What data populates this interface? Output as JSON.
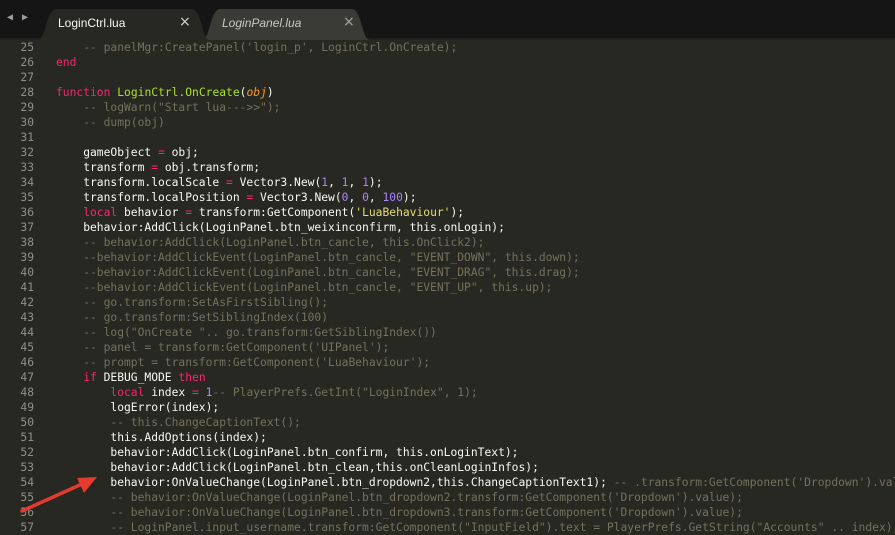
{
  "tabs": [
    {
      "label": "LoginCtrl.lua",
      "close": "×",
      "active": true
    },
    {
      "label": "LoginPanel.lua",
      "close": "×",
      "active": false
    }
  ],
  "nav": {
    "prev": "◀",
    "next": "▶"
  },
  "colors": {
    "background": "#272822",
    "keyword": "#f92672",
    "function": "#a6e22e",
    "string": "#e6db74",
    "number": "#ae81ff",
    "comment": "#75715e",
    "annotation_arrow": "#e53a2f"
  },
  "lines": [
    {
      "n": "25",
      "indent": 4,
      "tokens": [
        {
          "t": "-- panelMgr:CreatePanel('login_p', LoginCtrl.OnCreate);",
          "c": "cm"
        }
      ]
    },
    {
      "n": "26",
      "indent": 0,
      "tokens": [
        {
          "t": "end",
          "c": "kw"
        }
      ]
    },
    {
      "n": "27",
      "indent": 0,
      "tokens": []
    },
    {
      "n": "28",
      "indent": 0,
      "tokens": [
        {
          "t": "function",
          "c": "kw"
        },
        {
          "t": " "
        },
        {
          "t": "LoginCtrl.OnCreate",
          "c": "fn"
        },
        {
          "t": "("
        },
        {
          "t": "obj",
          "c": "param"
        },
        {
          "t": ")"
        }
      ]
    },
    {
      "n": "29",
      "indent": 4,
      "tokens": [
        {
          "t": "-- logWarn(\"Start lua--->>\");",
          "c": "cm"
        }
      ]
    },
    {
      "n": "30",
      "indent": 4,
      "tokens": [
        {
          "t": "-- dump(obj)",
          "c": "cm"
        }
      ]
    },
    {
      "n": "31",
      "indent": 0,
      "tokens": []
    },
    {
      "n": "32",
      "indent": 4,
      "tokens": [
        {
          "t": "gameObject "
        },
        {
          "t": "=",
          "c": "op"
        },
        {
          "t": " obj;"
        }
      ]
    },
    {
      "n": "33",
      "indent": 4,
      "tokens": [
        {
          "t": "transform "
        },
        {
          "t": "=",
          "c": "op"
        },
        {
          "t": " obj.transform;"
        }
      ]
    },
    {
      "n": "34",
      "indent": 4,
      "tokens": [
        {
          "t": "transform.localScale "
        },
        {
          "t": "=",
          "c": "op"
        },
        {
          "t": " Vector3.New("
        },
        {
          "t": "1",
          "c": "num"
        },
        {
          "t": ", "
        },
        {
          "t": "1",
          "c": "num"
        },
        {
          "t": ", "
        },
        {
          "t": "1",
          "c": "num"
        },
        {
          "t": ");"
        }
      ]
    },
    {
      "n": "35",
      "indent": 4,
      "tokens": [
        {
          "t": "transform.localPosition "
        },
        {
          "t": "=",
          "c": "op"
        },
        {
          "t": " Vector3.New("
        },
        {
          "t": "0",
          "c": "num"
        },
        {
          "t": ", "
        },
        {
          "t": "0",
          "c": "num"
        },
        {
          "t": ", "
        },
        {
          "t": "100",
          "c": "num"
        },
        {
          "t": ");"
        }
      ]
    },
    {
      "n": "36",
      "indent": 4,
      "tokens": [
        {
          "t": "local",
          "c": "kw"
        },
        {
          "t": " behavior "
        },
        {
          "t": "=",
          "c": "op"
        },
        {
          "t": " transform:GetComponent("
        },
        {
          "t": "'LuaBehaviour'",
          "c": "str"
        },
        {
          "t": ");"
        }
      ]
    },
    {
      "n": "37",
      "indent": 4,
      "tokens": [
        {
          "t": "behavior:AddClick(LoginPanel.btn_weixinconfirm, this.onLogin);"
        }
      ]
    },
    {
      "n": "38",
      "indent": 4,
      "tokens": [
        {
          "t": "-- behavior:AddClick(LoginPanel.btn_cancle, this.OnClick2);",
          "c": "cm"
        }
      ]
    },
    {
      "n": "39",
      "indent": 4,
      "tokens": [
        {
          "t": "--behavior:AddClickEvent(LoginPanel.btn_cancle, \"EVENT_DOWN\", this.down);",
          "c": "cm"
        }
      ]
    },
    {
      "n": "40",
      "indent": 4,
      "tokens": [
        {
          "t": "--behavior:AddClickEvent(LoginPanel.btn_cancle, \"EVENT_DRAG\", this.drag);",
          "c": "cm"
        }
      ]
    },
    {
      "n": "41",
      "indent": 4,
      "tokens": [
        {
          "t": "--behavior:AddClickEvent(LoginPanel.btn_cancle, \"EVENT_UP\", this.up);",
          "c": "cm"
        }
      ]
    },
    {
      "n": "42",
      "indent": 4,
      "tokens": [
        {
          "t": "-- go.transform:SetAsFirstSibling();",
          "c": "cm"
        }
      ]
    },
    {
      "n": "43",
      "indent": 4,
      "tokens": [
        {
          "t": "-- go.transform:SetSiblingIndex(100)",
          "c": "cm"
        }
      ]
    },
    {
      "n": "44",
      "indent": 4,
      "tokens": [
        {
          "t": "-- log(\"OnCreate \".. go.transform:GetSiblingIndex())",
          "c": "cm"
        }
      ]
    },
    {
      "n": "45",
      "indent": 4,
      "tokens": [
        {
          "t": "-- panel = transform:GetComponent('UIPanel');",
          "c": "cm"
        }
      ]
    },
    {
      "n": "46",
      "indent": 4,
      "tokens": [
        {
          "t": "-- prompt = transform:GetComponent('LuaBehaviour');",
          "c": "cm"
        }
      ]
    },
    {
      "n": "47",
      "indent": 4,
      "tokens": [
        {
          "t": "if",
          "c": "kw"
        },
        {
          "t": " DEBUG_MODE "
        },
        {
          "t": "then",
          "c": "kw"
        }
      ]
    },
    {
      "n": "48",
      "indent": 8,
      "tokens": [
        {
          "t": "local",
          "c": "kw"
        },
        {
          "t": " index "
        },
        {
          "t": "=",
          "c": "op"
        },
        {
          "t": " "
        },
        {
          "t": "1",
          "c": "num"
        },
        {
          "t": "-- PlayerPrefs.GetInt(\"LoginIndex\", 1);",
          "c": "cm"
        }
      ]
    },
    {
      "n": "49",
      "indent": 8,
      "tokens": [
        {
          "t": "logError(index);"
        }
      ]
    },
    {
      "n": "50",
      "indent": 8,
      "tokens": [
        {
          "t": "-- this.ChangeCaptionText();",
          "c": "cm"
        }
      ]
    },
    {
      "n": "51",
      "indent": 8,
      "tokens": [
        {
          "t": "this.AddOptions(index);"
        }
      ]
    },
    {
      "n": "52",
      "indent": 8,
      "tokens": [
        {
          "t": "behavior:AddClick(LoginPanel.btn_confirm, this.onLoginText);"
        }
      ]
    },
    {
      "n": "53",
      "indent": 8,
      "tokens": [
        {
          "t": "behavior:AddClick(LoginPanel.btn_clean,this.onCleanLoginInfos);"
        }
      ]
    },
    {
      "n": "54",
      "indent": 8,
      "tokens": [
        {
          "t": "behavior:OnValueChange(LoginPanel.btn_dropdown2,this.ChangeCaptionText1); "
        },
        {
          "t": "-- .transform:GetComponent('Dropdown').value);",
          "c": "cm"
        }
      ]
    },
    {
      "n": "55",
      "indent": 8,
      "tokens": [
        {
          "t": "-- behavior:OnValueChange(LoginPanel.btn_dropdown2.transform:GetComponent('Dropdown').value);",
          "c": "cm"
        }
      ]
    },
    {
      "n": "56",
      "indent": 8,
      "tokens": [
        {
          "t": "-- behavior:OnValueChange(LoginPanel.btn_dropdown3.transform:GetComponent('Dropdown').value);",
          "c": "cm"
        }
      ]
    },
    {
      "n": "57",
      "indent": 8,
      "tokens": [
        {
          "t": "-- LoginPanel.input_username.transform:GetComponent(\"InputField\").text = PlayerPrefs.GetString(\"Accounts\" .. index);",
          "c": "cm"
        }
      ]
    }
  ]
}
